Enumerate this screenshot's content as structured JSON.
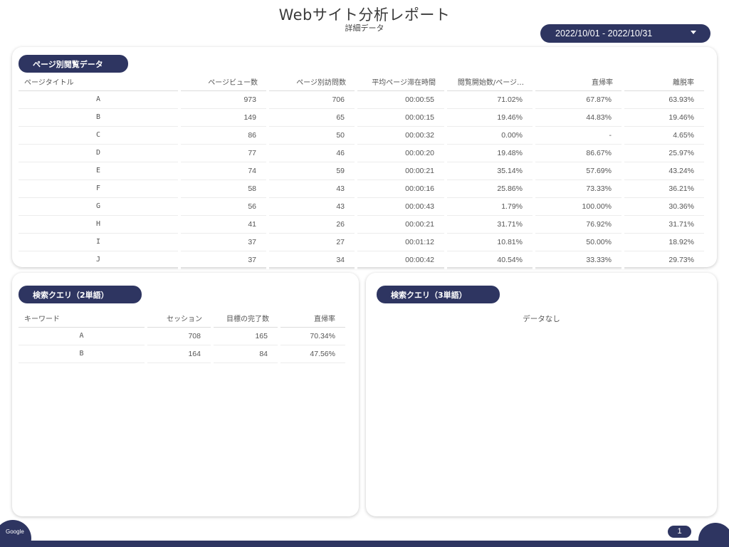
{
  "header": {
    "title": "Webサイト分析レポート",
    "subtitle": "詳細データ",
    "date_range": "2022/10/01 - 2022/10/31"
  },
  "page_table": {
    "label": "ページ別閲覧データ",
    "columns": [
      "ページタイトル",
      "ページビュー数",
      "ページ別訪問数",
      "平均ページ滞在時間",
      "閲覧開始数/ページ…",
      "直帰率",
      "離脱率"
    ],
    "rows": [
      [
        "A",
        "973",
        "706",
        "00:00:55",
        "71.02%",
        "67.87%",
        "63.93%"
      ],
      [
        "B",
        "149",
        "65",
        "00:00:15",
        "19.46%",
        "44.83%",
        "19.46%"
      ],
      [
        "C",
        "86",
        "50",
        "00:00:32",
        "0.00%",
        "-",
        "4.65%"
      ],
      [
        "D",
        "77",
        "46",
        "00:00:20",
        "19.48%",
        "86.67%",
        "25.97%"
      ],
      [
        "E",
        "74",
        "59",
        "00:00:21",
        "35.14%",
        "57.69%",
        "43.24%"
      ],
      [
        "F",
        "58",
        "43",
        "00:00:16",
        "25.86%",
        "73.33%",
        "36.21%"
      ],
      [
        "G",
        "56",
        "43",
        "00:00:43",
        "1.79%",
        "100.00%",
        "30.36%"
      ],
      [
        "H",
        "41",
        "26",
        "00:00:21",
        "31.71%",
        "76.92%",
        "31.71%"
      ],
      [
        "I",
        "37",
        "27",
        "00:01:12",
        "10.81%",
        "50.00%",
        "18.92%"
      ],
      [
        "J",
        "37",
        "34",
        "00:00:42",
        "40.54%",
        "33.33%",
        "29.73%"
      ]
    ]
  },
  "query2": {
    "label": "検索クエリ（2単語）",
    "columns": [
      "キーワード",
      "セッション",
      "目標の完了数",
      "直帰率"
    ],
    "rows": [
      [
        "A",
        "708",
        "165",
        "70.34%"
      ],
      [
        "B",
        "164",
        "84",
        "47.56%"
      ]
    ]
  },
  "query3": {
    "label": "検索クエリ（3単語）",
    "empty_text": "データなし"
  },
  "footer": {
    "brand": "Google",
    "page_number": "1"
  },
  "colors": {
    "accent": "#2e3561"
  }
}
